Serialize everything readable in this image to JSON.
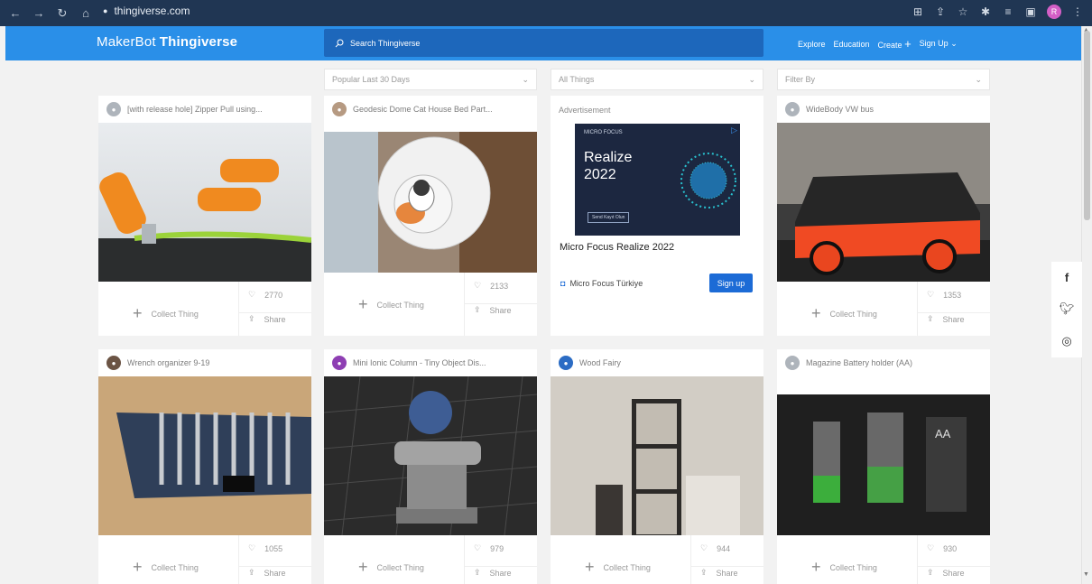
{
  "browser": {
    "url": "thingiverse.com",
    "avatar_letter": "R"
  },
  "site": {
    "logo_prefix": "MakerBot",
    "logo_name": "Thingiverse",
    "search_placeholder": "Search Thingiverse",
    "nav": [
      "Explore",
      "Education",
      "Create",
      "Sign Up"
    ]
  },
  "filters": [
    {
      "label": "Popular Last 30 Days"
    },
    {
      "label": "All Things"
    },
    {
      "label": "Filter By"
    }
  ],
  "actions": {
    "collect": "Collect Thing",
    "share": "Share"
  },
  "cards": [
    {
      "title": "[with release hole] Zipper Pull using...",
      "likes": "2770"
    },
    {
      "title": "Geodesic Dome Cat House Bed Part...",
      "likes": "2133"
    },
    {
      "title": "WideBody VW bus",
      "likes": "1353"
    },
    {
      "title": "Wrench organizer 9-19",
      "likes": "1055"
    },
    {
      "title": "Mini Ionic Column - Tiny Object Dis...",
      "likes": "979"
    },
    {
      "title": "Wood Fairy",
      "likes": "944"
    },
    {
      "title": "Magazine Battery holder (AA)",
      "likes": "930"
    }
  ],
  "ad": {
    "label": "Advertisement",
    "brand_small": "MICRO FOCUS",
    "headline_1": "Realize",
    "headline_2": "2022",
    "cta_small": "Send Kayıt Olun",
    "title": "Micro Focus Realize 2022",
    "source": "Micro Focus Türkiye",
    "button": "Sign up"
  },
  "colors": {
    "site_bar": "#2a8fe8",
    "chrome": "#203653",
    "search": "#1d67bb"
  }
}
